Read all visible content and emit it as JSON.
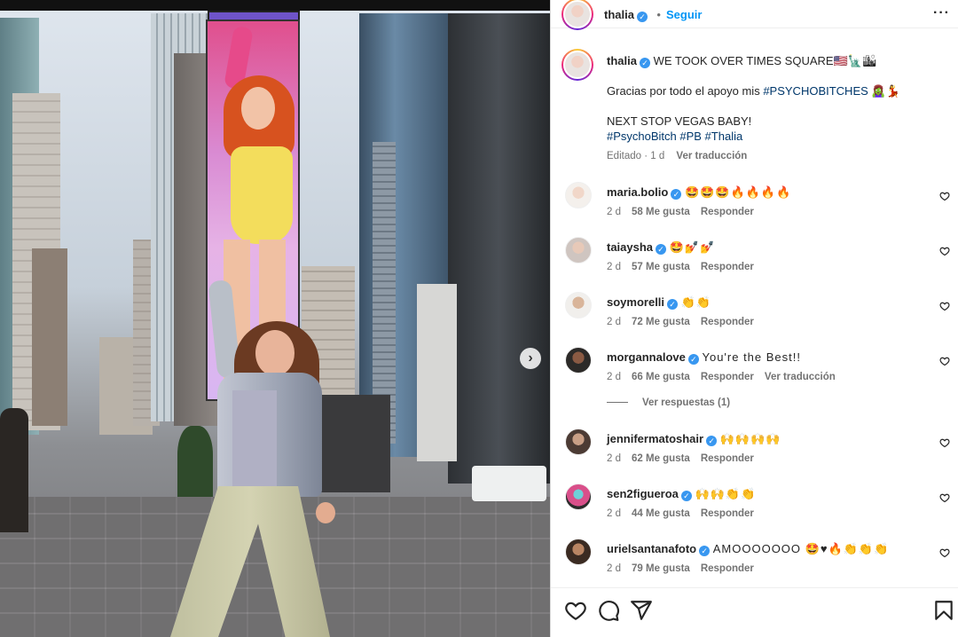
{
  "post": {
    "username": "thalia",
    "follow_label": "Seguir",
    "more_icon": "more-options-icon",
    "verified_glyph": "✓"
  },
  "caption": {
    "username": "thalia",
    "text": "WE TOOK OVER TIMES SQUARE🇺🇸🗽🏙",
    "line2_text": "Gracias por todo el apoyo mis ",
    "line2_tag": "#PSYCHOBITCHES",
    "line2_emoji": "🧟‍♀️💃",
    "line3": "NEXT STOP VEGAS BABY!",
    "hashtags": "#PsychoBitch #PB #Thalia",
    "edited": "Editado · 1 d",
    "see_translation": "Ver traducción"
  },
  "comments": [
    {
      "username": "maria.bolio",
      "text": "🤩🤩🤩🔥🔥🔥🔥",
      "age": "2 d",
      "likes": "58 Me gusta",
      "reply": "Responder",
      "translate": ""
    },
    {
      "username": "taiaysha",
      "text": "🤩💅💅",
      "age": "2 d",
      "likes": "57 Me gusta",
      "reply": "Responder",
      "translate": ""
    },
    {
      "username": "soymorelli",
      "text": "👏👏",
      "age": "2 d",
      "likes": "72 Me gusta",
      "reply": "Responder",
      "translate": ""
    },
    {
      "username": "morgannalove",
      "text": "You're the Best!!",
      "age": "2 d",
      "likes": "66 Me gusta",
      "reply": "Responder",
      "translate": "Ver traducción"
    },
    {
      "username": "jennifermatoshair",
      "text": "🙌🙌🙌🙌",
      "age": "2 d",
      "likes": "62 Me gusta",
      "reply": "Responder",
      "translate": ""
    },
    {
      "username": "sen2figueroa",
      "text": "🙌🙌👏👏",
      "age": "2 d",
      "likes": "44 Me gusta",
      "reply": "Responder",
      "translate": ""
    },
    {
      "username": "urielsantanafoto",
      "text": "AMOOOOOOO 🤩♥🔥👏👏👏",
      "age": "2 d",
      "likes": "79 Me gusta",
      "reply": "Responder",
      "translate": ""
    }
  ],
  "view_replies": "Ver respuestas (1)",
  "actions": {
    "like_icon": "heart-icon",
    "comment_icon": "comment-icon",
    "share_icon": "share-icon",
    "save_icon": "bookmark-icon"
  },
  "colors": {
    "link": "#0095f6",
    "hashtag": "#00376b",
    "verified": "#3897f0",
    "muted": "#737373"
  }
}
